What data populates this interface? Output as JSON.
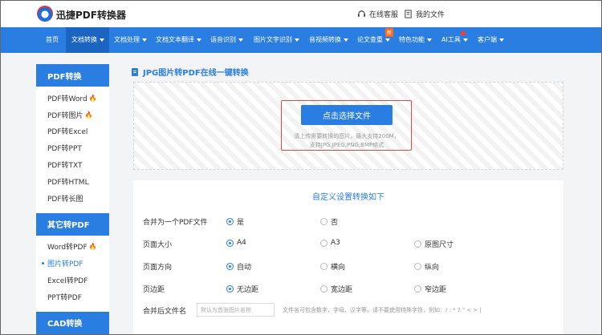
{
  "header": {
    "logo_text": "迅捷PDF转换器",
    "service_label": "在线客服",
    "files_label": "我的文件"
  },
  "nav": {
    "items": [
      {
        "label": "首页"
      },
      {
        "label": "文档转换"
      },
      {
        "label": "文档处理"
      },
      {
        "label": "文档文本翻译"
      },
      {
        "label": "语音识别"
      },
      {
        "label": "图片文字识别"
      },
      {
        "label": "音视频转换"
      },
      {
        "label": "论文查重"
      },
      {
        "label": "特色功能"
      },
      {
        "label": "AI工具"
      },
      {
        "label": "客户端"
      }
    ],
    "new_badge": "新"
  },
  "sidebar": {
    "sections": [
      {
        "title": "PDF转换",
        "items": [
          "PDF转Word",
          "PDF转图片",
          "PDF转Excel",
          "PDF转PPT",
          "PDF转TXT",
          "PDF转HTML",
          "PDF转长图"
        ]
      },
      {
        "title": "其它转PDF",
        "items": [
          "Word转PDF",
          "图片转PDF",
          "Excel转PDF",
          "PPT转PDF"
        ]
      },
      {
        "title": "CAD转换",
        "items": []
      }
    ]
  },
  "main": {
    "title": "JPG图片转PDF在线一键转换",
    "upload_button": "点击选择文件",
    "upload_hint_line1": "请上传需要转换的图片，最大支持200M，",
    "upload_hint_line2": "支持JPG,JPEG,PNG,BMP格式"
  },
  "settings": {
    "title": "自定义设置转换如下",
    "merge": {
      "label": "合并为一个PDF文件",
      "options": [
        "是",
        "否"
      ],
      "selected": "是"
    },
    "page_size": {
      "label": "页面大小",
      "options": [
        "A4",
        "A3",
        "原图尺寸"
      ],
      "selected": "A4"
    },
    "orientation": {
      "label": "页面方向",
      "options": [
        "自动",
        "横向",
        "纵向"
      ],
      "selected": "自动"
    },
    "margin": {
      "label": "页边距",
      "options": [
        "无边距",
        "宽边距",
        "窄边距"
      ],
      "selected": "无边距"
    },
    "filename": {
      "label": "合并后文件名",
      "placeholder": "默认为首张图片名称",
      "hint": "文件名可包含数字、字母、汉字等。请不要使用特殊字符，例如：/ : * ? \" < > |"
    }
  },
  "colors": {
    "accent": "#2a7de1",
    "red": "#e0483c"
  }
}
